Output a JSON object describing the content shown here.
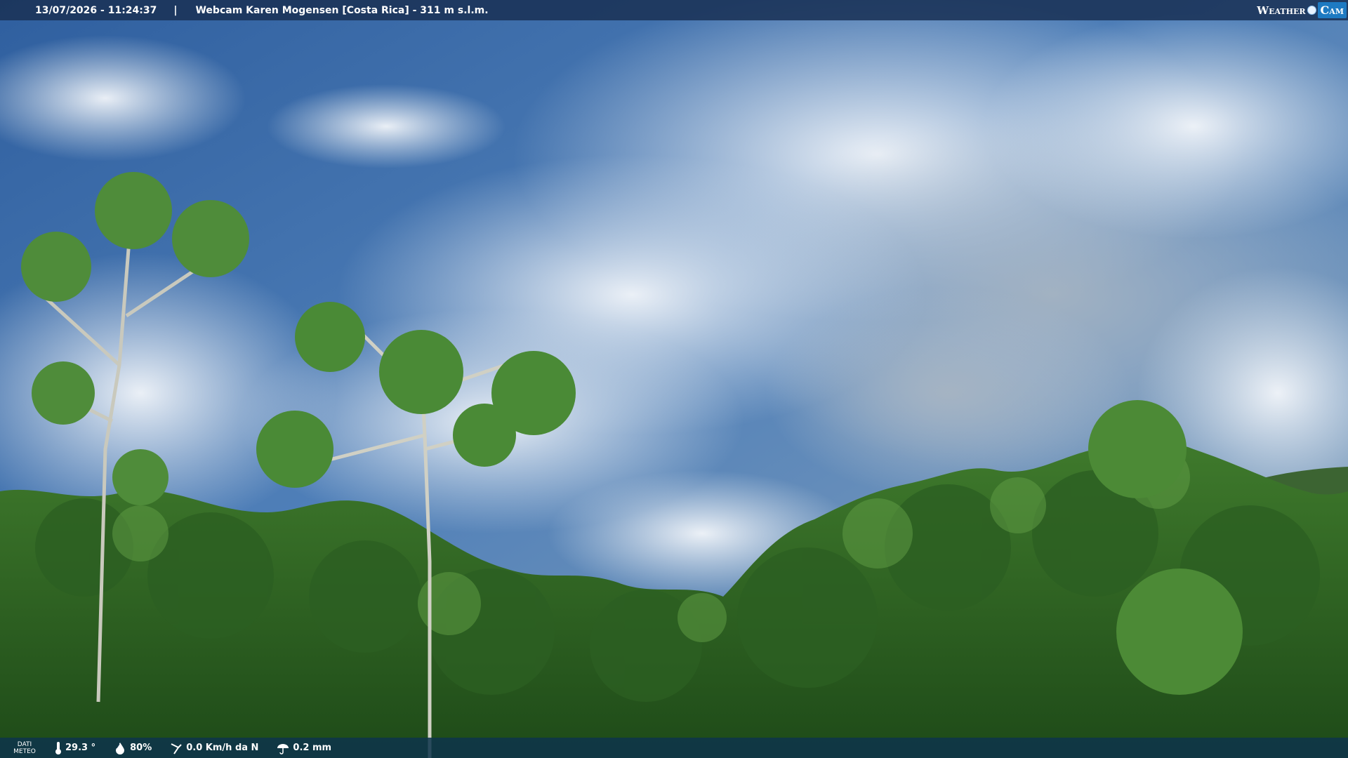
{
  "header": {
    "datetime": "13/07/2026 - 11:24:37",
    "separator": "|",
    "title": "Webcam Karen Mogensen [Costa Rica] - 311 m s.l.m."
  },
  "logo": {
    "left": "Weather",
    "right": "Cam"
  },
  "weather": {
    "section_label_line1": "DATI",
    "section_label_line2": "METEO",
    "temperature": "29.3 °",
    "humidity": "80%",
    "wind": "0.0 Km/h da N",
    "rain": "0.2 mm"
  },
  "icons": {
    "temperature": "thermometer-icon",
    "humidity": "droplet-icon",
    "wind": "wind-icon",
    "rain": "rain-icon"
  }
}
